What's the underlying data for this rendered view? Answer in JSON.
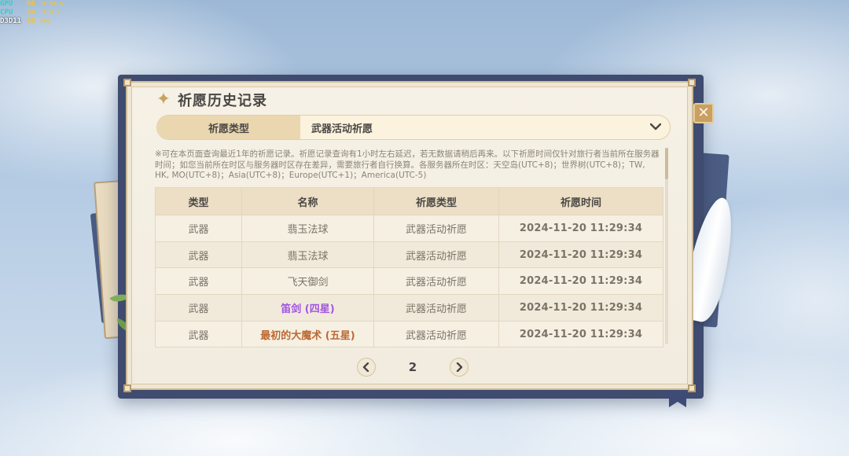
{
  "overlay": {
    "rows": [
      {
        "key": "GPU",
        "value": "60",
        "unit": "°C 58 %"
      },
      {
        "key": "CPU",
        "value": "84",
        "unit": "°C 8 %"
      },
      {
        "key": "D3D11",
        "value": "60",
        "unit": "FPS"
      }
    ]
  },
  "dialog": {
    "title": "祈愿历史记录",
    "title_icon": "sparkle-icon",
    "close_icon": "close-icon",
    "wish_type_label": "祈愿类型",
    "wish_type_value": "武器活动祈愿",
    "dropdown_icon": "chevron-down-icon",
    "notice": "※可在本页面查询最近1年的祈愿记录。祈愿记录查询有1小时左右延迟，若无数据请稍后再来。以下祈愿时间仅针对旅行者当前所在服务器时间；如您当前所在时区与服务器时区存在差异，需要旅行者自行换算。各服务器所在时区：天空岛(UTC+8)；世界树(UTC+8)；TW, HK, MO(UTC+8)；Asia(UTC+8)；Europe(UTC+1)；America(UTC-5)"
  },
  "table": {
    "headers": [
      "类型",
      "名称",
      "祈愿类型",
      "祈愿时间"
    ],
    "rows": [
      {
        "type": "武器",
        "name": "翡玉法球",
        "wish_type": "武器活动祈愿",
        "time": "2024-11-20 11:29:34",
        "rarity_color": "#7a7367"
      },
      {
        "type": "武器",
        "name": "翡玉法球",
        "wish_type": "武器活动祈愿",
        "time": "2024-11-20 11:29:34",
        "rarity_color": "#7a7367"
      },
      {
        "type": "武器",
        "name": "飞天御剑",
        "wish_type": "武器活动祈愿",
        "time": "2024-11-20 11:29:34",
        "rarity_color": "#7a7367"
      },
      {
        "type": "武器",
        "name": "笛剑 (四星)",
        "wish_type": "武器活动祈愿",
        "time": "2024-11-20 11:29:34",
        "rarity_color": "#a256e1"
      },
      {
        "type": "武器",
        "name": "最初的大魔术 (五星)",
        "wish_type": "武器活动祈愿",
        "time": "2024-11-20 11:29:34",
        "rarity_color": "#bd6932"
      }
    ]
  },
  "pagination": {
    "prev_icon": "chevron-left-icon",
    "next_icon": "chevron-right-icon",
    "current_page": "2"
  }
}
